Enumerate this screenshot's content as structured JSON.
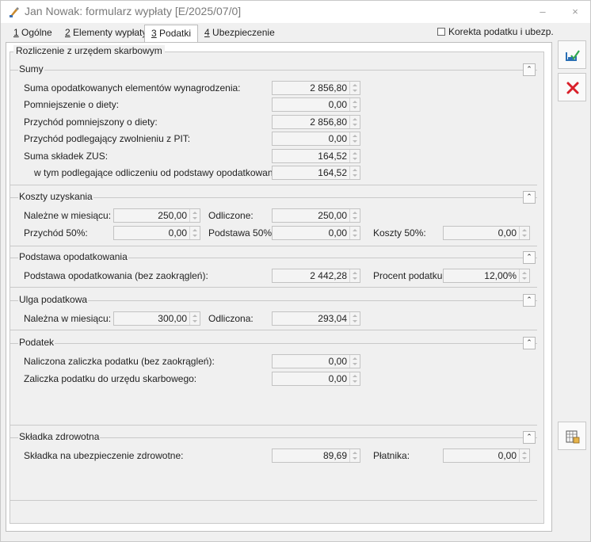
{
  "window": {
    "title": "Jan Nowak: formularz wypłaty [E/2025/07/0]",
    "minimize_glyph": "–",
    "close_glyph": "×"
  },
  "tabs": [
    {
      "key": "1",
      "label": " Ogólne"
    },
    {
      "key": "2",
      "label": " Elementy wypłaty"
    },
    {
      "key": "3",
      "label": " Podatki"
    },
    {
      "key": "4",
      "label": " Ubezpieczenie"
    }
  ],
  "korekta_label": "Korekta podatku i ubezp.",
  "outer_group_title": "Rozliczenie z urzędem skarbowym",
  "sumy": {
    "title": "Sumy",
    "rows": [
      {
        "label": "Suma opodatkowanych elementów wynagrodzenia:",
        "value": "2 856,80"
      },
      {
        "label": "Pomniejszenie o diety:",
        "value": "0,00"
      },
      {
        "label": "Przychód pomniejszony o diety:",
        "value": "2 856,80"
      },
      {
        "label": "Przychód podlegający zwolnieniu z PIT:",
        "value": "0,00"
      },
      {
        "label": "Suma składek ZUS:",
        "value": "164,52"
      },
      {
        "label": "w tym podlegające odliczeniu od podstawy opodatkowania:",
        "value": "164,52"
      }
    ]
  },
  "koszty": {
    "title": "Koszty uzyskania",
    "nalezne_label": "Należne w miesiącu:",
    "nalezne_value": "250,00",
    "odliczone_label": "Odliczone:",
    "odliczone_value": "250,00",
    "przychod50_label": "Przychód 50%:",
    "przychod50_value": "0,00",
    "podstawa50_label": "Podstawa 50%:",
    "podstawa50_value": "0,00",
    "koszty50_label": "Koszty 50%:",
    "koszty50_value": "0,00"
  },
  "podstawa": {
    "title": "Podstawa opodatkowania",
    "label": "Podstawa opodatkowania (bez zaokrągleń):",
    "value": "2 442,28",
    "procent_label": "Procent podatku:",
    "procent_value": "12,00%"
  },
  "ulga": {
    "title": "Ulga podatkowa",
    "nalezna_label": "Należna w miesiącu:",
    "nalezna_value": "300,00",
    "odliczona_label": "Odliczona:",
    "odliczona_value": "293,04"
  },
  "podatek": {
    "title": "Podatek",
    "naliczona_label": "Naliczona zaliczka podatku (bez zaokrągleń):",
    "naliczona_value": "0,00",
    "zaliczka_label": "Zaliczka podatku do urzędu skarbowego:",
    "zaliczka_value": "0,00"
  },
  "zdrowotna": {
    "title": "Składka zdrowotna",
    "label": "Składka na ubezpieczenie zdrowotne:",
    "value": "89,69",
    "platnika_label": "Płatnika:",
    "platnika_value": "0,00"
  },
  "collapse_glyph": "⌃",
  "icons": [
    "app-icon",
    "save-icon",
    "cancel-icon",
    "calculator-icon"
  ],
  "colors": {
    "cancel": "#d9202a",
    "save": "#2a6fb5"
  }
}
